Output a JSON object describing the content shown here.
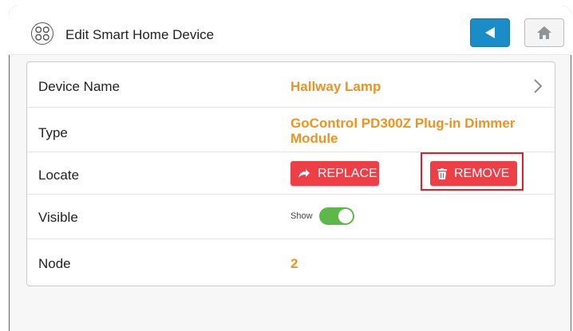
{
  "header": {
    "title": "Edit Smart Home Device"
  },
  "rows": {
    "device_name": {
      "label": "Device Name",
      "value": "Hallway Lamp"
    },
    "type": {
      "label": "Type",
      "value_line1": "GoControl PD300Z Plug-in Dimmer",
      "value_line2": "Module"
    },
    "locate": {
      "label": "Locate",
      "replace_label": "REPLACE",
      "remove_label": "REMOVE"
    },
    "visible": {
      "label": "Visible",
      "toggle_label": "Show",
      "toggle_on": true
    },
    "node": {
      "label": "Node",
      "value": "2"
    }
  },
  "colors": {
    "accent_orange": "#f2921d",
    "button_red": "#ef3f46",
    "toggle_green": "#5cb848",
    "back_blue": "#1a8cc7",
    "highlight_red": "#e21f26"
  },
  "icons": {
    "header": "smart-home-device-icon",
    "back": "back-arrow-icon",
    "home": "home-icon",
    "chevron": "chevron-right-icon",
    "replace": "share-arrow-icon",
    "remove": "trash-icon"
  }
}
